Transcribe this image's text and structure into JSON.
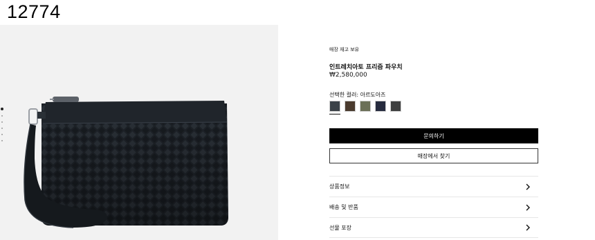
{
  "corner_id": "12774",
  "gallery": {
    "dot_count": 6,
    "active_index": 0,
    "bg_color": "#f2f2f2"
  },
  "product": {
    "availability": "매장 재고 보유",
    "title": "인트레치아토 프리즘 파우치",
    "price": "₩2,580,000"
  },
  "color_selector": {
    "label": "선택한 컬러: 아르도아즈",
    "swatches": [
      {
        "name": "ardoise",
        "color": "#3b4148",
        "selected": true
      },
      {
        "name": "brown",
        "color": "#4a3b2e",
        "selected": false
      },
      {
        "name": "olive",
        "color": "#6b7058",
        "selected": false
      },
      {
        "name": "navy",
        "color": "#262b3e",
        "selected": false
      },
      {
        "name": "charcoal",
        "color": "#3e3f3f",
        "selected": false
      }
    ]
  },
  "actions": {
    "inquire_label": "문의하기",
    "find_store_label": "매장에서 찾기"
  },
  "accordion": [
    {
      "label": "상품정보"
    },
    {
      "label": "배송 및 반품"
    },
    {
      "label": "선물 포장"
    }
  ]
}
